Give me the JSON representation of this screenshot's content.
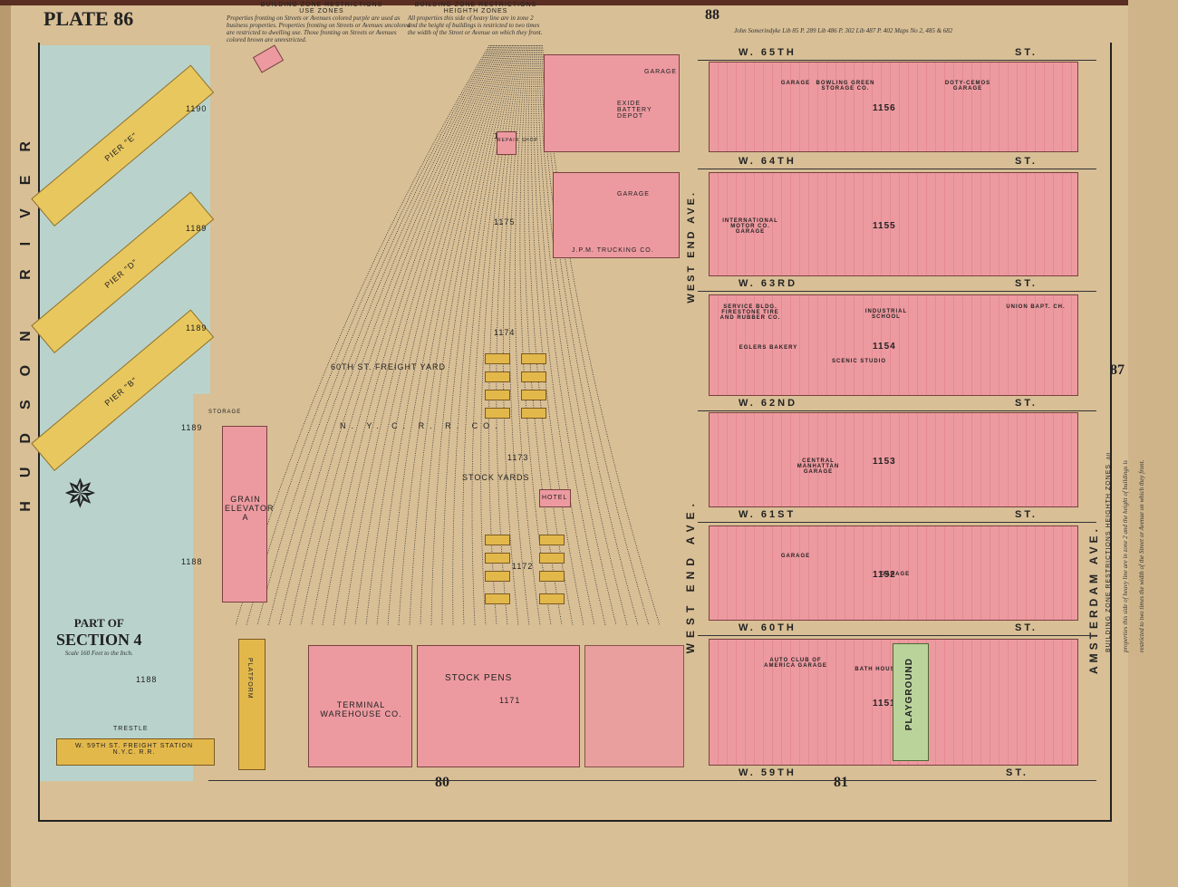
{
  "plate": "PLATE 86",
  "adjacent_plates": {
    "top": "88",
    "right": "87",
    "bottom_left": "80",
    "bottom_right": "81"
  },
  "use_zones": {
    "heading": "BUILDING ZONE RESTRICTIONS",
    "sub": "USE ZONES",
    "text": "Properties fronting on Streets or Avenues colored purple are used as business properties. Properties fronting on Streets or Avenues uncolored are restricted to dwelling use. Those fronting on Streets or Avenues colored brown are unrestricted."
  },
  "height_zones": {
    "heading": "BUILDING ZONE RESTRICTIONS",
    "sub": "HEIGHTH ZONES",
    "text": "All properties this side of heavy line are in zone 2 and the height of buildings is restricted to two times the width of the Street or Avenue on which they front."
  },
  "right_note": {
    "heading": "BUILDING ZONE RESTRICTIONS HEIGHTH ZONES",
    "text": "All properties this side of heavy line are in zone 2 and the height of buildings is restricted to two times the width of the Street or Avenue on which they front."
  },
  "deed_note": "John Somerindyke Lib 85 P. 289 Lib 486 P. 302 Lib 487 P. 402 Maps No 2, 485 & 682",
  "section": {
    "part": "PART OF",
    "name": "SECTION 4",
    "scale": "Scale 160 Feet to the Inch."
  },
  "river": "HUDSON RIVER",
  "piers": [
    {
      "label": "PIER \"E\"",
      "lot": "1190"
    },
    {
      "label": "PIER \"D\"",
      "lot": "1189"
    },
    {
      "label": "PIER \"B\"",
      "lot": "1189"
    }
  ],
  "streets": [
    "W. 65TH ST.",
    "W. 64TH ST.",
    "W. 63RD ST.",
    "W. 62ND ST.",
    "W. 61ST ST.",
    "W. 60TH ST.",
    "W. 59TH ST."
  ],
  "avenues": {
    "west": "WEST END AVE.",
    "east": "AMSTERDAM AVE."
  },
  "lots": [
    "1189",
    "1188",
    "1188",
    "1176",
    "1175",
    "1174",
    "1173",
    "1172",
    "1171",
    "1156",
    "1155",
    "1154",
    "1153",
    "1152",
    "1151"
  ],
  "labels": {
    "freight_yard": "60TH ST. FREIGHT YARD",
    "nyc": "N. Y. C.   R. R.   CO.",
    "stock_yards": "STOCK YARDS",
    "hotel": "HOTEL",
    "grain": "GRAIN ELEVATOR A",
    "storage": "STORAGE",
    "platform": "PLATFORM",
    "trestle": "TRESTLE",
    "freight_station": "W. 59TH ST. FREIGHT STATION N.Y.C. R.R.",
    "terminal": "TERMINAL WAREHOUSE CO.",
    "stock_pens": "STOCK PENS",
    "repair": "REPAIR SHOP",
    "exide": "EXIDE BATTERY DEPOT",
    "jpm": "J.P.M. TRUCKING CO.",
    "garage": "GARAGE",
    "intl_motor": "INTERNATIONAL MOTOR CO. GARAGE",
    "service": "SERVICE BLDG. FIRESTONE TIRE AND RUBBER CO.",
    "eglers": "EGLERS BAKERY",
    "industrial": "INDUSTRIAL SCHOOL",
    "union": "UNION BAPT. CH.",
    "central": "CENTRAL MANHATTAN GARAGE",
    "auto_club": "AUTO CLUB OF AMERICA GARAGE",
    "bath": "BATH HOUSE",
    "playground": "PLAYGROUND",
    "bowling": "BOWLING GREEN STORAGE CO.",
    "dotycemos": "DOTY-CEMOS GARAGE",
    "scenic": "SCENIC STUDIO"
  }
}
